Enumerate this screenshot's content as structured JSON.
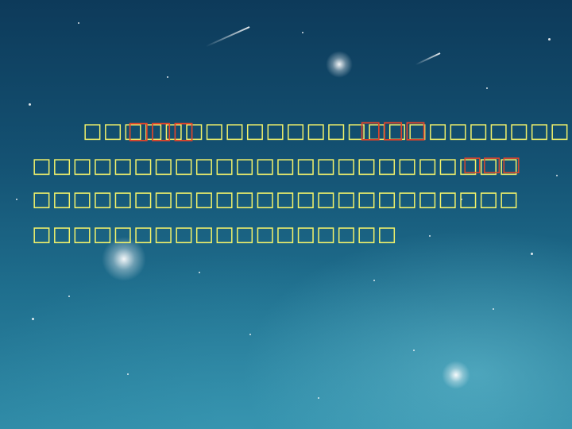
{
  "lines": [
    "□□□□□□□□□□□□□□□□□□□□□□□□□",
    "□□□□□□□□□□□□□□□□□□□□□□□□",
    "□□□□□□□□□□□□□□□□□□□□□□□□",
    "□□□□□□□□□□□□□□□□□□"
  ],
  "highlights": [
    "□□□",
    "□□□",
    "□□□"
  ]
}
